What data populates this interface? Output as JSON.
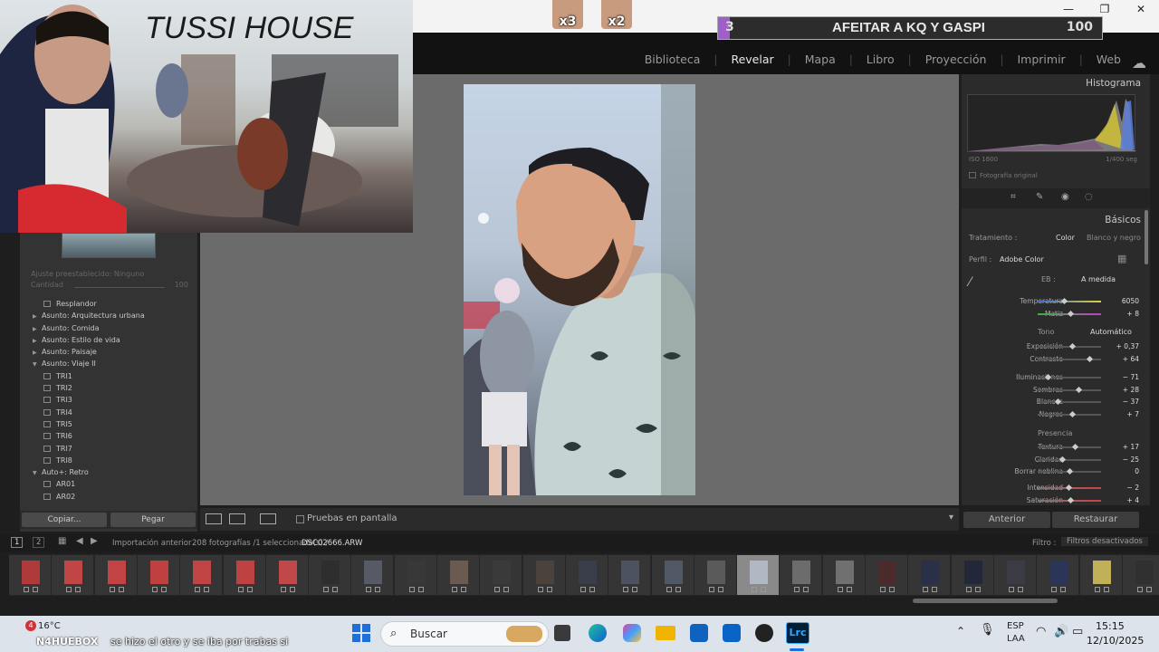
{
  "window": {
    "minimize": "—",
    "maximize": "❐",
    "close": "✕"
  },
  "modules": [
    "Biblioteca",
    "Revelar",
    "Mapa",
    "Libro",
    "Proyección",
    "Imprimir",
    "Web"
  ],
  "active_module": "Revelar",
  "stream": {
    "cam_title": "TUSSI HOUSE",
    "goal_current": "3",
    "goal_text": "AFEITAR A KQ Y GASPI",
    "goal_target": "100",
    "goal_fraction": 0.03,
    "faces": [
      {
        "mult": "x3"
      },
      {
        "mult": "x2"
      }
    ]
  },
  "left": {
    "preset_label": "Ajuste preestablecido:",
    "preset_value": "Ninguno",
    "amount_label": "Cantidad",
    "amount_value": "100",
    "tree": [
      {
        "label": "Resplandor",
        "type": "preset"
      },
      {
        "label": "Asunto: Arquitectura urbana",
        "type": "folder",
        "open": false
      },
      {
        "label": "Asunto: Comida",
        "type": "folder",
        "open": false
      },
      {
        "label": "Asunto: Estilo de vida",
        "type": "folder",
        "open": false
      },
      {
        "label": "Asunto: Paisaje",
        "type": "folder",
        "open": false
      },
      {
        "label": "Asunto: Viaje II",
        "type": "folder",
        "open": true
      },
      {
        "label": "TRI1",
        "type": "preset"
      },
      {
        "label": "TRI2",
        "type": "preset"
      },
      {
        "label": "TRI3",
        "type": "preset"
      },
      {
        "label": "TRI4",
        "type": "preset"
      },
      {
        "label": "TRI5",
        "type": "preset"
      },
      {
        "label": "TRI6",
        "type": "preset"
      },
      {
        "label": "TRI7",
        "type": "preset"
      },
      {
        "label": "TRI8",
        "type": "preset"
      },
      {
        "label": "Auto+: Retro",
        "type": "folder",
        "open": true
      },
      {
        "label": "AR01",
        "type": "preset"
      },
      {
        "label": "AR02",
        "type": "preset"
      }
    ],
    "copy_btn": "Copiar...",
    "paste_btn": "Pegar"
  },
  "toolbar": {
    "softproof": "Pruebas en pantalla"
  },
  "right": {
    "histogram_title": "Histograma",
    "iso": "ISO 1600",
    "shutter": "1/400 seg",
    "original_photo": "Fotografía original",
    "basics_title": "Básicos",
    "treatment_label": "Tratamiento :",
    "treatment_color": "Color",
    "treatment_bw": "Blanco y negro",
    "profile_label": "Perfil :",
    "profile_value": "Adobe Color",
    "wb_label": "EB :",
    "wb_value": "A medida",
    "tone_label": "Tono",
    "tone_auto": "Automático",
    "presence_label": "Presencia",
    "wb_sliders": [
      {
        "name": "Temperatura",
        "value": "6050",
        "pos": 0.42
      },
      {
        "name": "Matiz",
        "value": "+ 8",
        "pos": 0.52
      }
    ],
    "tone_sliders": [
      {
        "name": "Exposición",
        "value": "+ 0,37",
        "pos": 0.54
      },
      {
        "name": "Contraste",
        "value": "+ 64",
        "pos": 0.82
      }
    ],
    "light_sliders": [
      {
        "name": "Iluminaciones",
        "value": "− 71",
        "pos": 0.15
      },
      {
        "name": "Sombras",
        "value": "+ 28",
        "pos": 0.64
      },
      {
        "name": "Blancos",
        "value": "− 37",
        "pos": 0.32
      },
      {
        "name": "Negros",
        "value": "+ 7",
        "pos": 0.54
      }
    ],
    "presence_sliders": [
      {
        "name": "Textura",
        "value": "+ 17",
        "pos": 0.59
      },
      {
        "name": "Claridad",
        "value": "− 25",
        "pos": 0.38
      },
      {
        "name": "Borrar neblina",
        "value": "0",
        "pos": 0.5
      }
    ],
    "color_sliders": [
      {
        "name": "Intensidad",
        "value": "− 2",
        "pos": 0.49
      },
      {
        "name": "Saturación",
        "value": "+ 4",
        "pos": 0.52
      }
    ],
    "prev_btn": "Anterior",
    "reset_btn": "Restaurar"
  },
  "filmstrip_bar": {
    "screen1": "1",
    "screen2": "2",
    "source": "Importación anterior",
    "count": "208 fotografías /1 seleccionada(s) /",
    "filename": "DSC02666.ARW",
    "filter_label": "Filtro :",
    "filter_value": "Filtros desactivados"
  },
  "filmstrip": {
    "count": 27,
    "selected_index": 17,
    "thumb_colors": [
      "#b03a3a",
      "#c04545",
      "#c24343",
      "#c04040",
      "#c04444",
      "#bf4242",
      "#c04848",
      "#2e2e2e",
      "#555a66",
      "#383838",
      "#6a5a50",
      "#3a3a3a",
      "#4b423c",
      "#3a3e4a",
      "#4c5260",
      "#505866",
      "#5a5a5a",
      "#b0b8c4",
      "#6c6c6c",
      "#707070",
      "#4a2a2a",
      "#2a3048",
      "#22273a",
      "#3b3b45",
      "#2a3558",
      "#c0b058",
      "#303030"
    ]
  },
  "taskbar": {
    "notif_count": "4",
    "temperature": "16°C",
    "chat_user": "N4HUEBOX",
    "chat_message": "se hizo el otro y se iba por trabas si",
    "search_placeholder": "Buscar",
    "lang": "ESP",
    "lang2": "LAA",
    "time": "15:15",
    "date": "12/10/2025"
  }
}
